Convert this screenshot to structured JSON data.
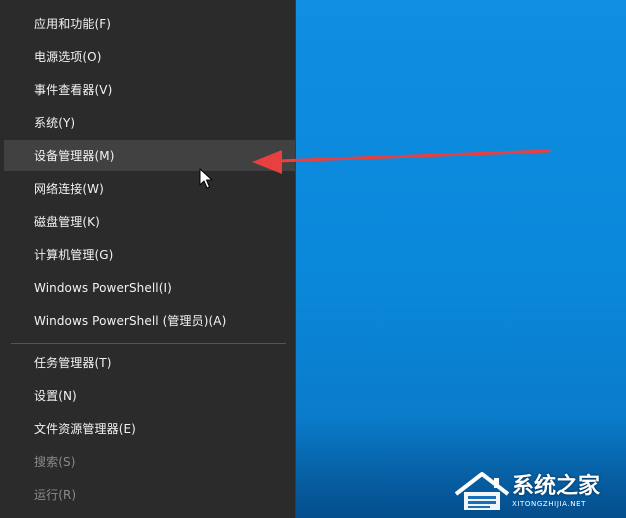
{
  "menu": {
    "items": [
      {
        "label": "应用和功能(F)"
      },
      {
        "label": "电源选项(O)"
      },
      {
        "label": "事件查看器(V)"
      },
      {
        "label": "系统(Y)"
      },
      {
        "label": "设备管理器(M)"
      },
      {
        "label": "网络连接(W)"
      },
      {
        "label": "磁盘管理(K)"
      },
      {
        "label": "计算机管理(G)"
      },
      {
        "label": "Windows PowerShell(I)"
      },
      {
        "label": "Windows PowerShell (管理员)(A)"
      },
      {
        "label": "任务管理器(T)"
      },
      {
        "label": "设置(N)"
      },
      {
        "label": "文件资源管理器(E)"
      },
      {
        "label": "搜索(S)"
      },
      {
        "label": "运行(R)"
      }
    ]
  },
  "watermark": {
    "main": "系统之家",
    "sub": "XITONGZHIJIA.NET"
  },
  "colors": {
    "menu_bg": "#2b2b2b",
    "hover_bg": "#414141",
    "desktop": "#0a87d9",
    "arrow": "#e8403f"
  },
  "icons": {
    "cursor": "mouse-pointer-icon",
    "arrow": "red-arrow-annotation",
    "logo": "house-logo-icon"
  }
}
